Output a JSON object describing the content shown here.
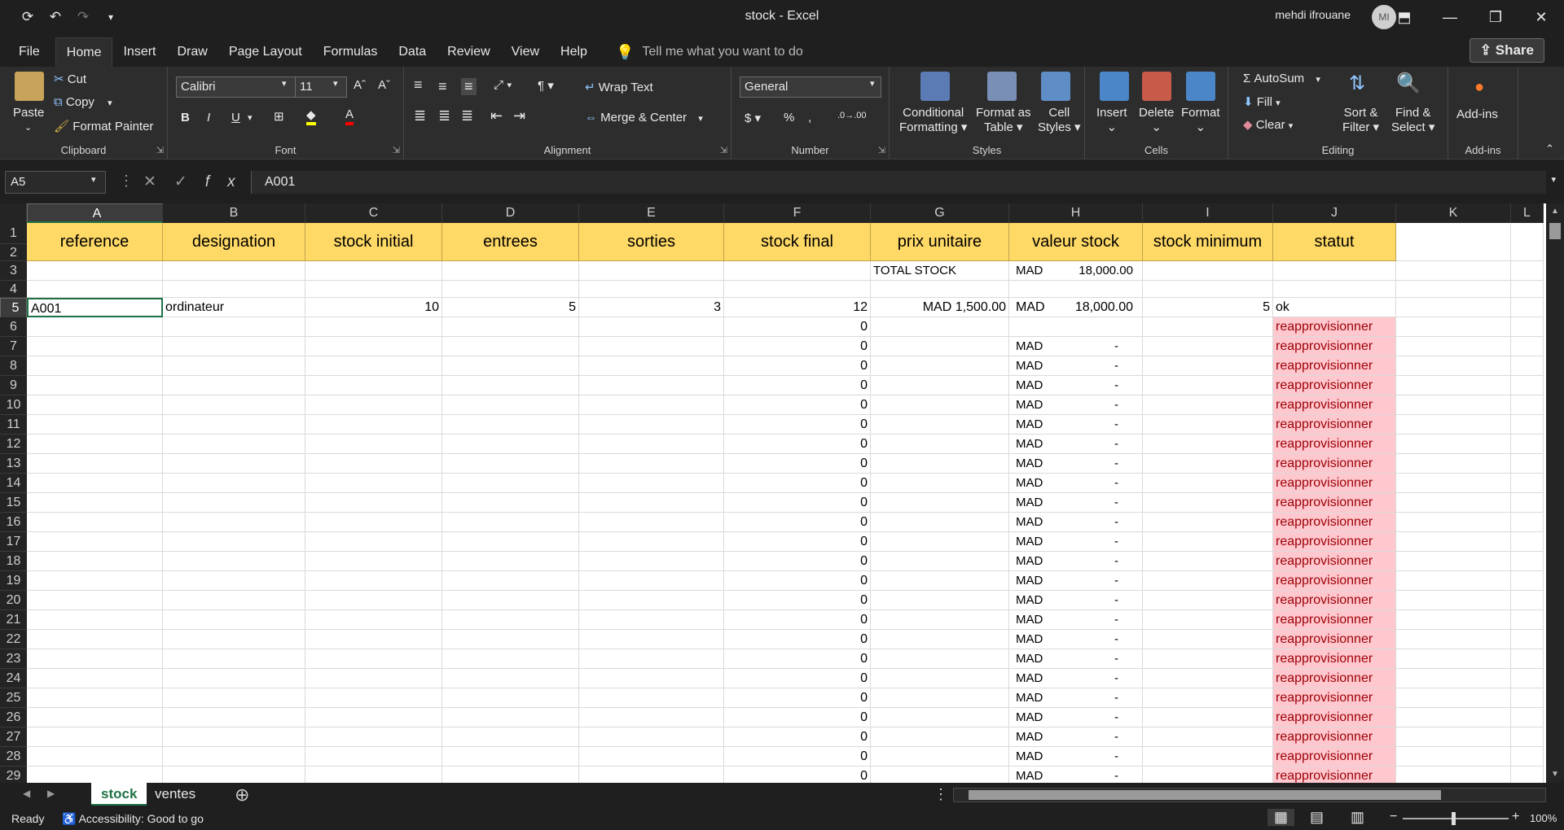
{
  "window": {
    "title": "stock  -  Excel",
    "user": "mehdi ifrouane",
    "initials": "MI"
  },
  "menu": {
    "tabs": [
      "File",
      "Home",
      "Insert",
      "Draw",
      "Page Layout",
      "Formulas",
      "Data",
      "Review",
      "View",
      "Help"
    ],
    "active": "Home",
    "tell_me": "Tell me what you want to do",
    "share": "Share"
  },
  "ribbon": {
    "clipboard": {
      "paste": "Paste",
      "cut": "Cut",
      "copy": "Copy",
      "format_painter": "Format Painter",
      "label": "Clipboard"
    },
    "font": {
      "name": "Calibri",
      "size": "11",
      "bold": "B",
      "italic": "I",
      "underline": "U",
      "label": "Font"
    },
    "alignment": {
      "wrap": "Wrap Text",
      "merge": "Merge & Center",
      "label": "Alignment"
    },
    "number": {
      "format": "General",
      "label": "Number"
    },
    "styles": {
      "conditional": "Conditional",
      "conditional2": "Formatting",
      "format_as": "Format as",
      "format_as2": "Table",
      "cell": "Cell",
      "cell2": "Styles",
      "label": "Styles"
    },
    "cells": {
      "insert": "Insert",
      "delete": "Delete",
      "format": "Format",
      "label": "Cells"
    },
    "editing": {
      "autosum": "AutoSum",
      "fill": "Fill",
      "clear": "Clear",
      "sort": "Sort &",
      "sort2": "Filter",
      "find": "Find &",
      "find2": "Select",
      "label": "Editing"
    },
    "addins": {
      "addins": "Add-ins",
      "label": "Add-ins"
    }
  },
  "formula_bar": {
    "name_box": "A5",
    "value": "A001"
  },
  "grid": {
    "columns": [
      "A",
      "B",
      "C",
      "D",
      "E",
      "F",
      "G",
      "H",
      "I",
      "J",
      "K",
      "L"
    ],
    "headers": [
      "reference",
      "designation",
      "stock initial",
      "entrees",
      "sorties",
      "stock final",
      "prix unitaire",
      "valeur stock",
      "stock minimum",
      "statut"
    ],
    "row3": {
      "label": "TOTAL STOCK",
      "currency": "MAD",
      "value": "18,000.00"
    },
    "row5": {
      "reference": "A001",
      "designation": "ordinateur",
      "stock_initial": "10",
      "entrees": "5",
      "sorties": "3",
      "stock_final": "12",
      "prix_unitaire": "MAD 1,500.00",
      "currency": "MAD",
      "valeur": "18,000.00",
      "stock_min": "5",
      "statut": "ok"
    },
    "row6": {
      "stock_final": "0",
      "statut": "reapprovisionner"
    },
    "repeat_row": {
      "stock_final": "0",
      "currency": "MAD",
      "valeur": "-",
      "statut": "reapprovisionner"
    },
    "row_numbers": [
      "1",
      "2",
      "3",
      "4",
      "5",
      "6",
      "7",
      "8",
      "9",
      "10",
      "11",
      "12",
      "13",
      "14",
      "15",
      "16",
      "17",
      "18",
      "19",
      "20",
      "21",
      "22",
      "23",
      "24",
      "25",
      "26",
      "27",
      "28",
      "29"
    ]
  },
  "sheets": {
    "tabs": [
      "stock",
      "ventes"
    ],
    "active": "stock"
  },
  "status": {
    "ready": "Ready",
    "accessibility": "Accessibility: Good to go",
    "zoom": "100%"
  },
  "colors": {
    "header_fill": "#ffd966",
    "bad_fill": "#ffc7ce",
    "bad_text": "#9c0006",
    "excel_green": "#1e7145"
  }
}
